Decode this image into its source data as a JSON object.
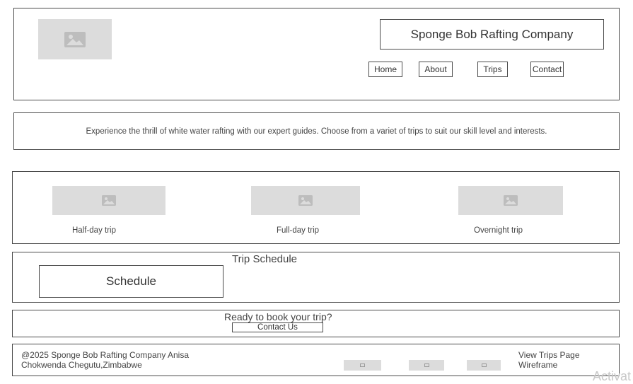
{
  "header": {
    "company_name": "Sponge Bob Rafting Company",
    "logo_icon": "image-placeholder-icon",
    "nav": [
      "Home",
      "About",
      "Trips",
      "Contact"
    ]
  },
  "intro": {
    "text": "Experience the thrill of white water rafting with our expert guides. Choose from a variet of trips to suit  our skill level  and interests."
  },
  "trips": [
    {
      "label": "Half-day trip",
      "icon": "image-placeholder-icon"
    },
    {
      "label": "Full-day trip",
      "icon": "image-placeholder-icon"
    },
    {
      "label": "Overnight trip",
      "icon": "image-placeholder-icon"
    }
  ],
  "schedule": {
    "title": "Trip Schedule",
    "box_label": "Schedule"
  },
  "booking": {
    "prompt": "Ready to book your trip?",
    "button": "Contact Us"
  },
  "footer": {
    "copyright_line1": "@2025 Sponge Bob Rafting Company Anisa",
    "copyright_line2": "Chokwenda Chegutu,Zimbabwe",
    "social_icons": [
      "social-icon",
      "social-icon",
      "social-icon"
    ],
    "page_title_line1": "View Trips Page",
    "page_title_line2": "Wireframe"
  },
  "watermark": "Activat"
}
